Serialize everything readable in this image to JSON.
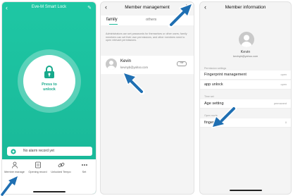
{
  "screen_home": {
    "title": "Eve-M Smart Lock",
    "press_label_line1": "Press to",
    "press_label_line2": "unlock",
    "alarm_text": "No alarm record yet",
    "tabs": [
      {
        "label": "Member manage",
        "icon": "person-icon"
      },
      {
        "label": "Opening record",
        "icon": "document-icon"
      },
      {
        "label": "Unlocked Tempo",
        "icon": "link-icon"
      },
      {
        "label": "Set",
        "icon": "more-icon"
      }
    ]
  },
  "screen_members": {
    "title": "Member management",
    "tabs": [
      "family",
      "others"
    ],
    "description": "Administrators can set passwords for themselves or other users; family members can set their own permissions, and other members need to open relevant permissions.",
    "member": {
      "name": "Kevin",
      "email": "kevinyb@yahoo.com",
      "badge": "me"
    }
  },
  "screen_info": {
    "title": "Member information",
    "name": "Kevin",
    "email": "kevinyb@yahoo.com",
    "sections": [
      {
        "header": "Permission settings",
        "rows": [
          {
            "label": "Fingerprint management",
            "value": "open"
          },
          {
            "label": "app unlock",
            "value": "open"
          }
        ]
      },
      {
        "header": "Time set",
        "rows": [
          {
            "label": "Age setting",
            "value": "permanent"
          }
        ]
      },
      {
        "header": "Open mode",
        "rows": [
          {
            "label": "finger",
            "value": "0"
          }
        ]
      }
    ]
  },
  "colors": {
    "accent": "#1bb999",
    "arrow": "#1f6fb2"
  }
}
